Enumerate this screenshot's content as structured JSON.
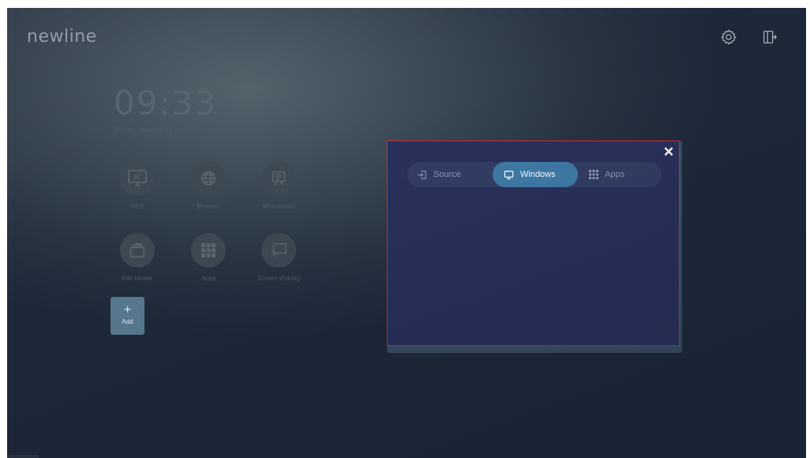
{
  "brand": {
    "logo": "newline"
  },
  "header": {
    "settings_icon": "gear-icon",
    "exit_icon": "exit-icon"
  },
  "home": {
    "clock": "09:33",
    "date": "Friday January 01",
    "apps": [
      {
        "label": "OPS",
        "icon": "pc-icon"
      },
      {
        "label": "Browser",
        "icon": "globe-icon"
      },
      {
        "label": "Whiteboard",
        "icon": "whiteboard-icon"
      },
      {
        "label": "File viewer",
        "icon": "folder-icon"
      },
      {
        "label": "Apps",
        "icon": "grid-icon"
      },
      {
        "label": "Screen sharing",
        "icon": "screen-share-icon"
      }
    ],
    "add": {
      "symbol": "+",
      "label": "Add"
    }
  },
  "panel": {
    "close_symbol": "✕",
    "tabs": [
      {
        "label": "Source",
        "icon": "input-icon",
        "active": false
      },
      {
        "label": "Windows",
        "icon": "monitor-icon",
        "active": true
      },
      {
        "label": "Apps",
        "icon": "grid-icon",
        "active": false
      }
    ]
  },
  "colors": {
    "accent": "#3f7aa6",
    "panel_bg": "#29305a",
    "highlight_border": "#e3222b",
    "add_tile": "#587a90"
  }
}
